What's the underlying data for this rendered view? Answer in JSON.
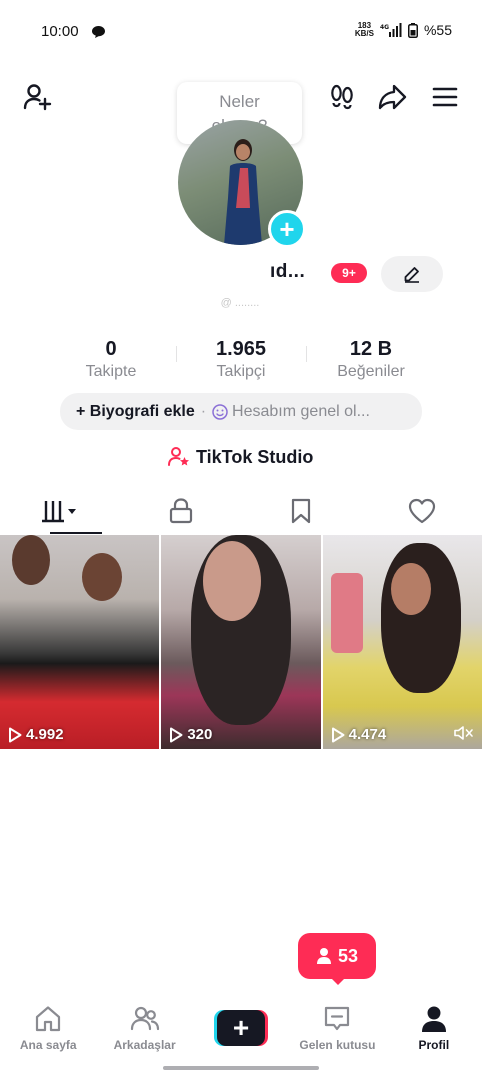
{
  "status_bar": {
    "time": "10:00",
    "speed_top": "183",
    "speed_bottom": "KB/S",
    "network": "4G",
    "battery": "%55"
  },
  "header": {
    "tooltip": "Neler oluyor?"
  },
  "profile": {
    "username": "ıd...",
    "notification_badge": "9+",
    "handle": "@ ........"
  },
  "stats": [
    {
      "value": "0",
      "label": "Takipte"
    },
    {
      "value": "1.965",
      "label": "Takipçi"
    },
    {
      "value": "12 B",
      "label": "Beğeniler"
    }
  ],
  "bio": {
    "add_label": "+ Biyografi ekle",
    "separator": "·",
    "note": "Hesabım genel ol..."
  },
  "studio": {
    "label": "TikTok Studio"
  },
  "videos": [
    {
      "views": "4.992"
    },
    {
      "views": "320"
    },
    {
      "views": "4.474"
    }
  ],
  "notification_pill": {
    "count": "53"
  },
  "bottom_nav": {
    "home": "Ana sayfa",
    "friends": "Arkadaşlar",
    "inbox": "Gelen kutusu",
    "profile": "Profil"
  },
  "colors": {
    "accent_red": "#fe2c55",
    "accent_cyan": "#20d5ec",
    "text_primary": "#161823",
    "text_secondary": "#8a8b91"
  }
}
